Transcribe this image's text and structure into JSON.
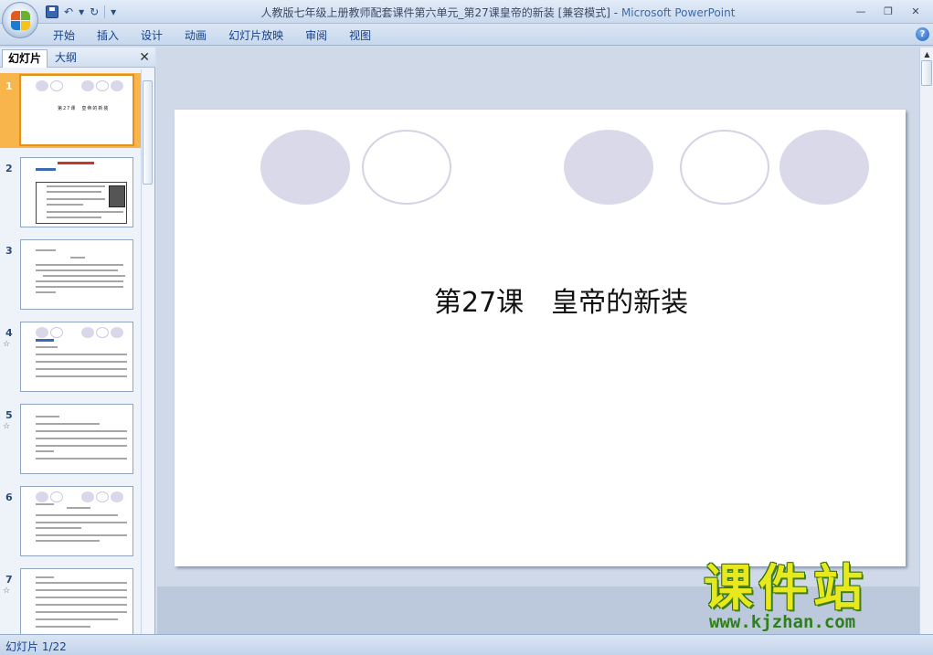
{
  "window": {
    "title": "人教版七年级上册教师配套课件第六单元_第27课皇帝的新装 [兼容模式] - ",
    "app_name": "Microsoft PowerPoint",
    "controls": [
      "—",
      "❐",
      "✕"
    ]
  },
  "quick_access": {
    "save": "save-icon",
    "undo": "↶",
    "undo_drop": "▾",
    "redo": "↻",
    "customize": "▾"
  },
  "ribbon": {
    "tabs": [
      "开始",
      "插入",
      "设计",
      "动画",
      "幻灯片放映",
      "审阅",
      "视图"
    ],
    "help": "?"
  },
  "left_panel": {
    "tab_slides": "幻灯片",
    "tab_outline": "大纲",
    "close": "✕",
    "thumbnails": [
      {
        "num": "1",
        "star": ""
      },
      {
        "num": "2",
        "star": ""
      },
      {
        "num": "3",
        "star": ""
      },
      {
        "num": "4",
        "star": "☆"
      },
      {
        "num": "5",
        "star": "☆"
      },
      {
        "num": "6",
        "star": ""
      },
      {
        "num": "7",
        "star": "☆"
      }
    ],
    "thumb1_title": "第27课　皇帝的新装"
  },
  "slide": {
    "title": "第27课　皇帝的新装"
  },
  "watermark": {
    "cn": "课件站",
    "url": "www.kjzhan.com"
  },
  "status": {
    "slide_counter": "幻灯片 1/22"
  }
}
